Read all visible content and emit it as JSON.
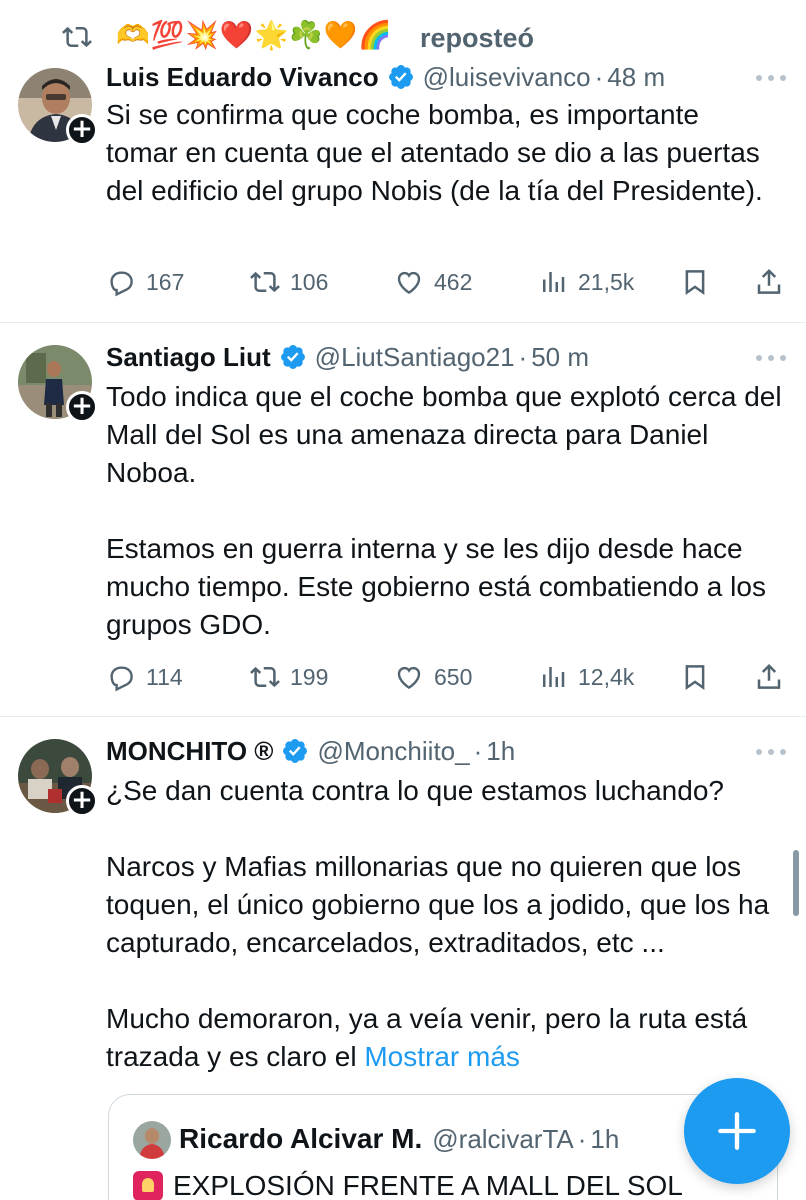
{
  "repost": {
    "emojis": "🫶💯💥❤️🌟☘️🧡🌈",
    "label": "reposteó"
  },
  "tweets": [
    {
      "name": "Luis Eduardo Vivanco",
      "handle": "@luisevivanco",
      "separator": "·",
      "time": "48 m",
      "paragraphs": [
        "Si se confirma que coche bomba, es importante tomar en cuenta que el atentado se dio a las puertas del edificio del grupo Nobis (de la tía del Presidente)."
      ],
      "replies": "167",
      "reposts": "106",
      "likes": "462",
      "views": "21,5k"
    },
    {
      "name": "Santiago Liut",
      "handle": "@LiutSantiago21",
      "separator": "·",
      "time": "50 m",
      "paragraphs": [
        "Todo indica que el coche bomba que explotó cerca del Mall del Sol es una amenaza directa para Daniel Noboa.",
        "",
        "Estamos en guerra interna y se les dijo desde hace mucho tiempo. Este gobierno está combatiendo a los grupos GDO."
      ],
      "replies": "114",
      "reposts": "199",
      "likes": "650",
      "views": "12,4k"
    },
    {
      "name": "MONCHITO ®",
      "handle": "@Monchiito_",
      "separator": "·",
      "time": "1h",
      "paragraphs": [
        "¿Se dan cuenta contra lo que estamos luchando?",
        "",
        "Narcos y Mafias millonarias que no quieren que los toquen, el único gobierno que los a jodido, que los ha capturado, encarcelados, extraditados, etc ...",
        "",
        "Mucho demoraron, ya a veía venir, pero la ruta está trazada y es claro el"
      ],
      "show_more": "Mostrar más"
    }
  ],
  "quote": {
    "name": "Ricardo Alcivar M.",
    "handle": "@ralcivarTA",
    "separator": "·",
    "time": "1h",
    "text": "EXPLOSIÓN FRENTE A MALL DEL SOL"
  },
  "icons": {
    "repost": "repost-icon",
    "verified": "verified-badge-icon",
    "more": "more-options-icon",
    "reply": "reply-icon",
    "like": "like-icon",
    "views": "views-icon",
    "bookmark": "bookmark-icon",
    "share": "share-icon",
    "compose": "compose-plus-icon",
    "siren": "siren-emoji-icon"
  },
  "colors": {
    "accent": "#1d9bf0",
    "text": "#0f1419",
    "secondary": "#536471",
    "divider": "#e6ecf0"
  }
}
